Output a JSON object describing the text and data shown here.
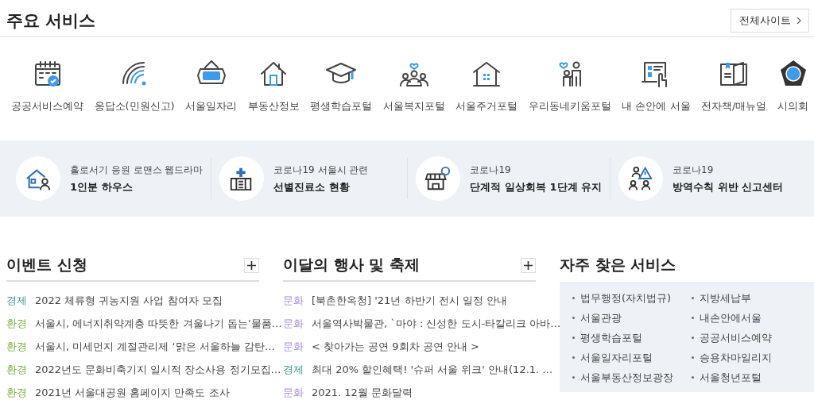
{
  "header": {
    "title": "주요 서비스",
    "all_sites": "전체사이트"
  },
  "services": [
    {
      "label": "공공서비스예약"
    },
    {
      "label": "응답소(민원신고)"
    },
    {
      "label": "서울일자리"
    },
    {
      "label": "부동산정보"
    },
    {
      "label": "평생학습포털"
    },
    {
      "label": "서울복지포털"
    },
    {
      "label": "서울주거포털"
    },
    {
      "label": "우리동네키움포털"
    },
    {
      "label": "내 손안에 서울"
    },
    {
      "label": "전자책/매뉴얼"
    },
    {
      "label": "시의회"
    }
  ],
  "notices": [
    {
      "line1": "홀로서기 응원 로맨스 웹드라마",
      "line2": "1인분 하우스"
    },
    {
      "line1": "코로나19 서울시 관련",
      "line2": "선별진료소 현황"
    },
    {
      "line1": "코로나19",
      "line2": "단계적 일상회복 1단계 유지"
    },
    {
      "line1": "코로나19",
      "line2": "방역수칙 위반 신고센터"
    }
  ],
  "sections": [
    {
      "title": "이벤트 신청",
      "items": [
        {
          "category": "경제",
          "color": "#3a9a8c",
          "title": "2022 체류형 귀농지원 사업 참여자 모집"
        },
        {
          "category": "환경",
          "color": "#78ad3c",
          "title": "서울시, 에너지취약계층 따뜻한 겨울나기 돕는‘물품…"
        },
        {
          "category": "환경",
          "color": "#78ad3c",
          "title": "서울시, 미세먼지 계절관리제 ‘맑은 서울하늘 감탄…"
        },
        {
          "category": "환경",
          "color": "#78ad3c",
          "title": "2022년도 문화비축기지 일시적 장소사용 정기모집…"
        },
        {
          "category": "환경",
          "color": "#78ad3c",
          "title": "2021년 서울대공원 홈페이지 만족도 조사"
        }
      ]
    },
    {
      "title": "이달의 행사 및 축제",
      "items": [
        {
          "category": "문화",
          "color": "#a58ad8",
          "title": "[북촌한옥청] '21년 하반기 전시 일정 안내"
        },
        {
          "category": "문화",
          "color": "#a58ad8",
          "title": "서울역사박물관, `마야 : 신성한 도시-타칼리크 아바…"
        },
        {
          "category": "문화",
          "color": "#a58ad8",
          "title": "< 찾아가는 공연 9회차 공연 안내 >"
        },
        {
          "category": "경제",
          "color": "#3a9a8c",
          "title": "최대 20% 할인혜택! '슈퍼 서울 위크' 안내(12.1. …"
        },
        {
          "category": "문화",
          "color": "#a58ad8",
          "title": "2021. 12월 문화달력"
        }
      ]
    }
  ],
  "frequent": {
    "title": "자주 찾은 서비스",
    "items": [
      "법무행정(자치법규)",
      "지방세납부",
      "서울관광",
      "내손안에서울",
      "평생학습포털",
      "공공서비스예약",
      "서울일자리포털",
      "승용차마일리지",
      "서울부동산정보광장",
      "서울청년포털"
    ]
  }
}
